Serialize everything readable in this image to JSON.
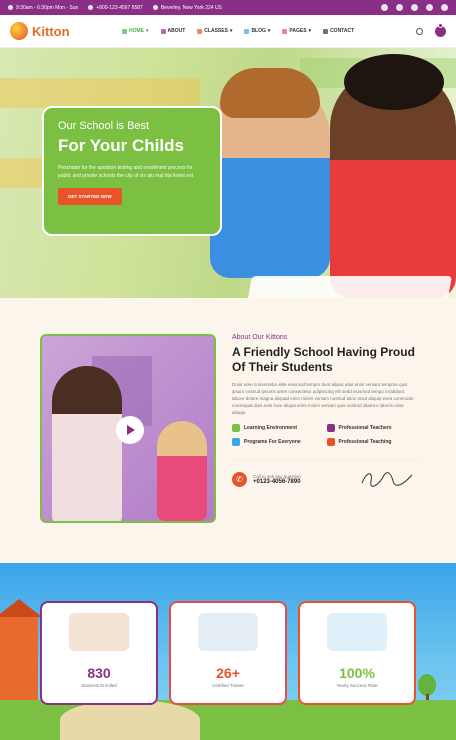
{
  "topbar": {
    "hours": "9:30am - 6:30pm Mon - Sun",
    "phone": "+800-123-4567 6587",
    "address": "Beverley, New York 224 US"
  },
  "nav": {
    "brand": "Kitton",
    "items": [
      {
        "label": "HOME",
        "active": true
      },
      {
        "label": "ABOUT",
        "active": false
      },
      {
        "label": "CLASSES",
        "active": false
      },
      {
        "label": "BLOG",
        "active": false
      },
      {
        "label": "PAGES",
        "active": false
      },
      {
        "label": "CONTACT",
        "active": false
      }
    ],
    "cart_count": "0"
  },
  "hero": {
    "kicker": "Our School is Best",
    "title": "For Your Childs",
    "text": "Peschdan for the apostion testing and enrollment process for public and private schools the city of xis alu mat tita kotes est",
    "button": "GET STARTED NOW"
  },
  "about": {
    "kicker": "About Our Kittons",
    "title": "A Friendly School Having Proud Of Their Students",
    "paragraph": "Dolor ame consectetur elite eiusmod tempor dunt aliqua utas enim veniam tempore quis ipsum nostrud ipsums amet consectetur adipisicing elit sedd eiusmod tempo incididunt labore dolore magna aliquad enim minim veniam nostrud ation nisut aliquip exea commodo consequat duis aute irure aliqua enim minim veniam quis nostrud ullamco laboris nisut aliquip",
    "features": [
      {
        "label": "Learning Environment",
        "color": "#7bc043"
      },
      {
        "label": "Professional Teachers",
        "color": "#8a2f86"
      },
      {
        "label": "Programs For Everyone",
        "color": "#3aa5e8"
      },
      {
        "label": "Professional Teaching",
        "color": "#e8532a"
      }
    ],
    "contact_label": "Call to ask any question",
    "contact_phone": "+0123-4056-7890"
  },
  "stats": [
    {
      "value": "830",
      "label": "Students Enrolled",
      "color": "#8a2f86",
      "border": "#8a2f86"
    },
    {
      "value": "26+",
      "label": "Certified Trainer",
      "color": "#e8532a",
      "border": "#e84a4a"
    },
    {
      "value": "100%",
      "label": "Yearly Success Rate",
      "color": "#7bc043",
      "border": "#e8532a"
    }
  ],
  "colors": {
    "brand_purple": "#8a2f86",
    "brand_green": "#7bc043",
    "brand_orange": "#e8532a"
  }
}
